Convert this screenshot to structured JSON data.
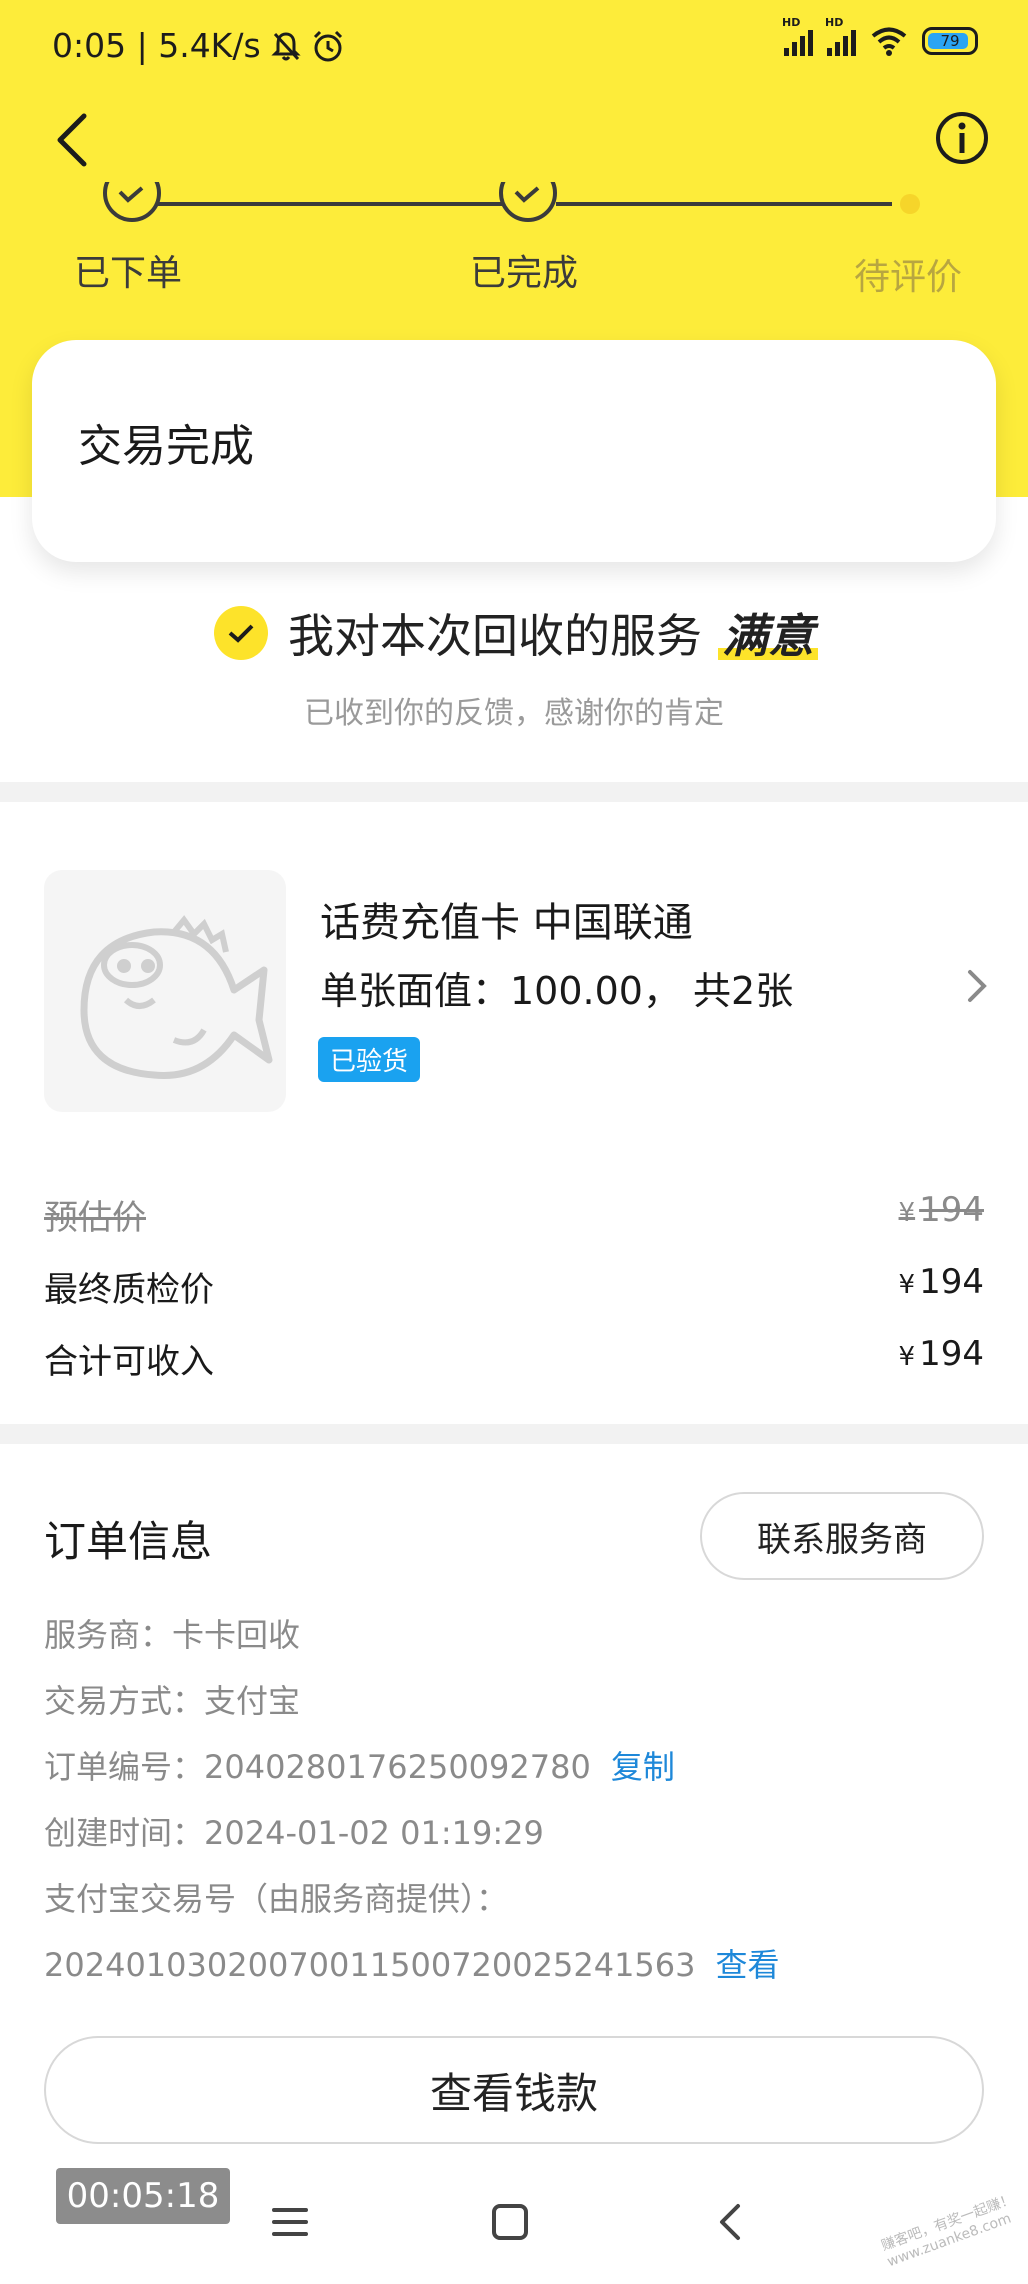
{
  "status_bar": {
    "time_speed": "0:05 | 5.4K/s",
    "hd1": "HD",
    "hd2": "HD",
    "battery": "79"
  },
  "progress": {
    "steps": [
      "已下单",
      "已完成",
      "待评价"
    ],
    "line_color": "#3b3b3b",
    "pending_color": "#f6d52a"
  },
  "status_card": {
    "title": "交易完成"
  },
  "satisfaction": {
    "text": "我对本次回收的服务",
    "level": "满意",
    "sub": "已收到你的反馈，感谢你的肯定"
  },
  "product": {
    "name": "话费充值卡 中国联通",
    "spec": "单张面值：100.00， 共2张",
    "badge": "已验货"
  },
  "prices": {
    "currency": "¥",
    "estimated_label": "预估价",
    "estimated_value": "194",
    "final_label": "最终质检价",
    "final_value": "194",
    "total_label": "合计可收入",
    "total_value": "194"
  },
  "order": {
    "title": "订单信息",
    "contact_button": "联系服务商",
    "provider": "服务商：卡卡回收",
    "payment": "交易方式：支付宝",
    "order_no": "订单编号：2040280176250092780",
    "copy": "复制",
    "created": "创建时间：2024-01-02 01:19:29",
    "alipay_label": "支付宝交易号（由服务商提供）：",
    "alipay_no": "2024010302007001150072002524156​3",
    "view": "查看"
  },
  "main_button": "查看钱款",
  "timer": "00:05:18",
  "watermark": "赚客吧，有奖一起赚！ www.zuanke8.com",
  "colors": {
    "brand_yellow": "#fdec3a",
    "link_blue": "#1e88d9",
    "badge_blue": "#1aa2f0"
  }
}
